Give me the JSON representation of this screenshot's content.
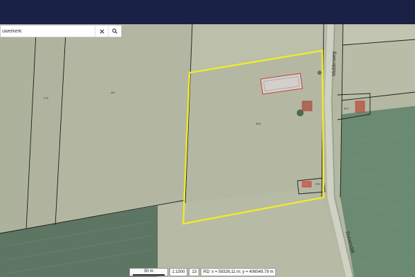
{
  "search": {
    "value": "uwerkerk",
    "clear_icon": "close-icon",
    "search_icon": "search-icon"
  },
  "parcels": {
    "west_label": "278",
    "middle_label": "487",
    "selected_label": "598",
    "east_label": "594",
    "south_label": "595"
  },
  "roads": {
    "north_road": "Middenweg",
    "south_road": "Duivendijk"
  },
  "status": {
    "scale_bar": "50 m",
    "scale_ratio": "1:1500",
    "zoom": "13",
    "coords": "RD: x = 59326,11 m; y = 406549,79 m"
  },
  "colors": {
    "header": "#1a2146",
    "selection": "#f2e92c",
    "parcel_line": "#1a1a1a"
  }
}
